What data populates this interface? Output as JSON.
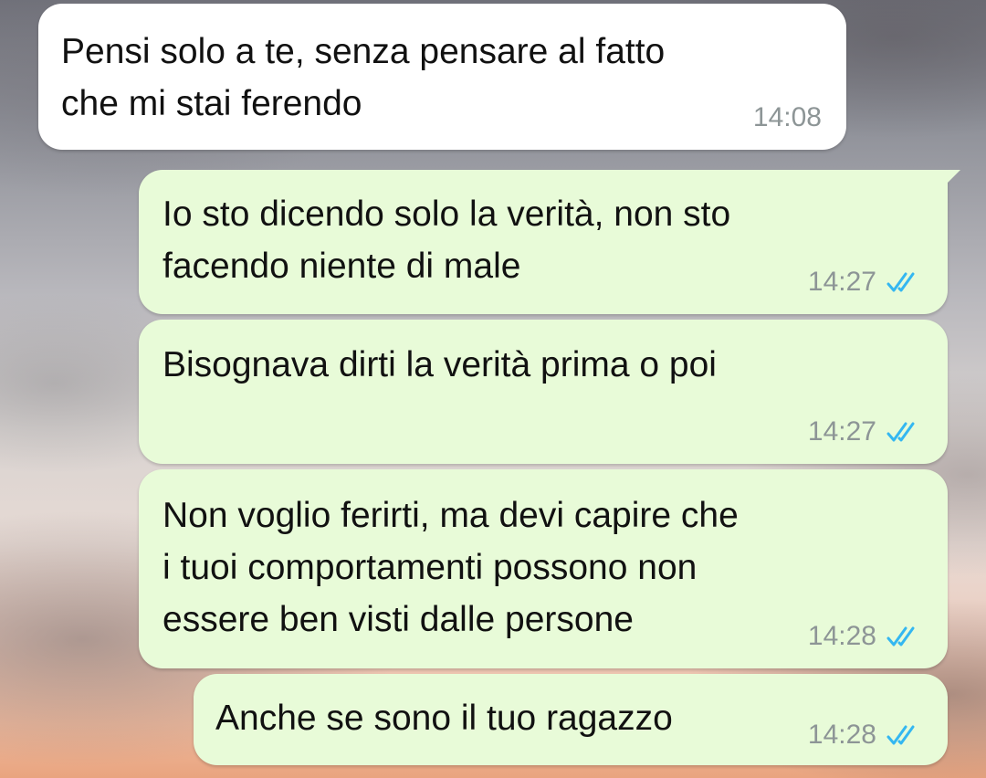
{
  "conversation": {
    "messages": [
      {
        "direction": "incoming",
        "text": "Pensi solo a te, senza pensare al fatto\nche mi stai ferendo",
        "time": "14:08"
      },
      {
        "direction": "outgoing",
        "text": "Io sto dicendo solo la verità, non sto\nfacendo niente di male",
        "time": "14:27",
        "status_icon": "double-check-read"
      },
      {
        "direction": "outgoing",
        "text": "Bisognava dirti la verità prima o poi",
        "time": "14:27",
        "status_icon": "double-check-read"
      },
      {
        "direction": "outgoing",
        "text": "Non voglio ferirti, ma devi capire che\ni tuoi comportamenti possono non\nessere ben visti dalle persone",
        "time": "14:28",
        "status_icon": "double-check-read"
      },
      {
        "direction": "outgoing",
        "text": "Anche se sono il tuo ragazzo",
        "time": "14:28",
        "status_icon": "double-check-read"
      }
    ]
  },
  "colors": {
    "incoming_bubble": "#ffffff",
    "outgoing_bubble": "#e8fbd8",
    "read_ticks": "#34b7f1",
    "timestamp": "#8d9596",
    "message_text": "#111111"
  }
}
